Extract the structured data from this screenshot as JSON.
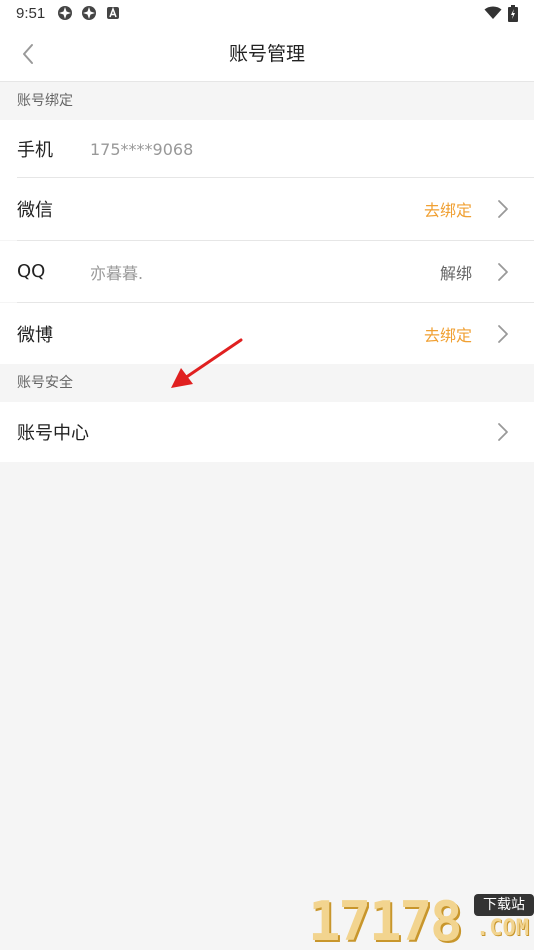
{
  "status_bar": {
    "time": "9:51"
  },
  "nav": {
    "title": "账号管理"
  },
  "binding_section": {
    "header": "账号绑定",
    "rows": [
      {
        "label": "手机",
        "value": "175****9068",
        "action": ""
      },
      {
        "label": "微信",
        "value": "",
        "action": "去绑定"
      },
      {
        "label": "QQ",
        "value": "亦暮暮.",
        "action": "解绑"
      },
      {
        "label": "微博",
        "value": "",
        "action": "去绑定"
      }
    ]
  },
  "security_section": {
    "header": "账号安全",
    "rows": [
      {
        "label": "账号中心"
      }
    ]
  },
  "watermark": {
    "digits": "17178",
    "badge": "下载站",
    "suffix": ".COM"
  },
  "colors": {
    "accent_orange": "#f0a033",
    "annotation_red": "#e02020"
  }
}
